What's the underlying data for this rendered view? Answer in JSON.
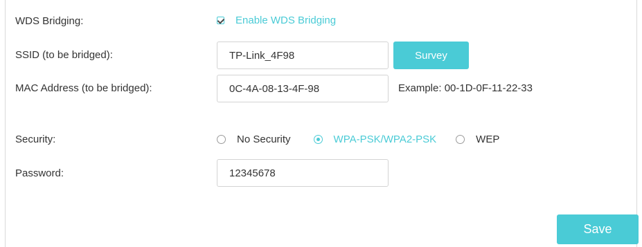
{
  "wds": {
    "label": "WDS Bridging:",
    "checkbox_label": "Enable WDS Bridging",
    "enabled": true
  },
  "ssid": {
    "label": "SSID (to be bridged):",
    "value": "TP-Link_4F98",
    "survey_label": "Survey"
  },
  "mac": {
    "label": "MAC Address (to be bridged):",
    "value": "0C-4A-08-13-4F-98",
    "example": "Example: 00-1D-0F-11-22-33"
  },
  "security": {
    "label": "Security:",
    "options": [
      "No Security",
      "WPA-PSK/WPA2-PSK",
      "WEP"
    ],
    "selected": "WPA-PSK/WPA2-PSK"
  },
  "password": {
    "label": "Password:",
    "value": "12345678"
  },
  "actions": {
    "save_label": "Save"
  },
  "colors": {
    "accent": "#4acbd6",
    "text": "#333333",
    "border": "#d3d3d3"
  }
}
